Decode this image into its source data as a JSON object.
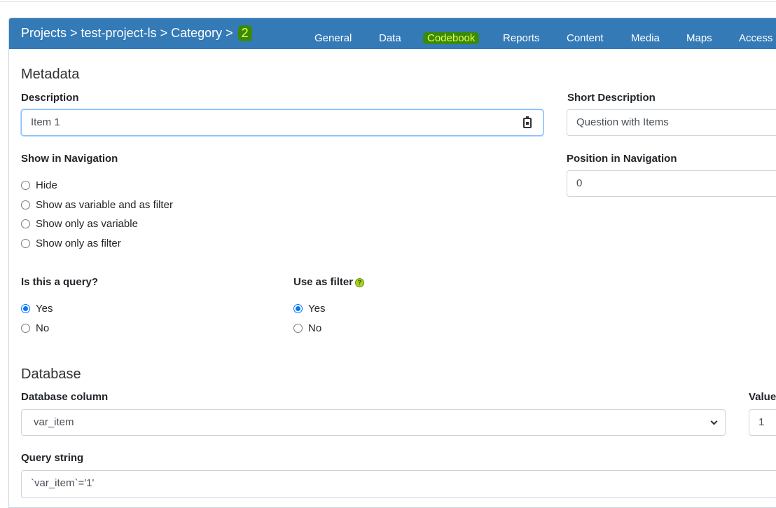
{
  "breadcrumb": {
    "items": [
      "Projects",
      "test-project-ls",
      "Category"
    ],
    "separator": ">",
    "current": "2"
  },
  "nav": {
    "tabs": [
      "General",
      "Data",
      "Codebook",
      "Reports",
      "Content",
      "Media",
      "Maps",
      "Access"
    ],
    "active": "Codebook"
  },
  "metadata": {
    "title": "Metadata",
    "description_label": "Description",
    "description_value": "Item 1",
    "short_description_label": "Short Description",
    "short_description_value": "Question with Items",
    "show_in_nav_label": "Show in Navigation",
    "show_in_nav_options": [
      "Hide",
      "Show as variable and as filter",
      "Show only as variable",
      "Show only as filter"
    ],
    "position_label": "Position in Navigation",
    "position_value": "0",
    "query_label": "Is this a query?",
    "query_options": [
      "Yes",
      "No"
    ],
    "query_selected": "Yes",
    "filter_label": "Use as filter",
    "filter_help_icon": "?",
    "filter_options": [
      "Yes",
      "No"
    ],
    "filter_selected": "Yes"
  },
  "database": {
    "title": "Database",
    "column_label": "Database column",
    "column_value": "var_item",
    "value_label": "Value",
    "value_value": "1",
    "query_string_label": "Query string",
    "query_string_value": "`var_item`='1'"
  },
  "colors": {
    "header_bg": "#337ab7",
    "highlight_bg": "#3a8a0a",
    "highlight_text": "#e8ff4c",
    "radio_checked": "#0075ff"
  }
}
